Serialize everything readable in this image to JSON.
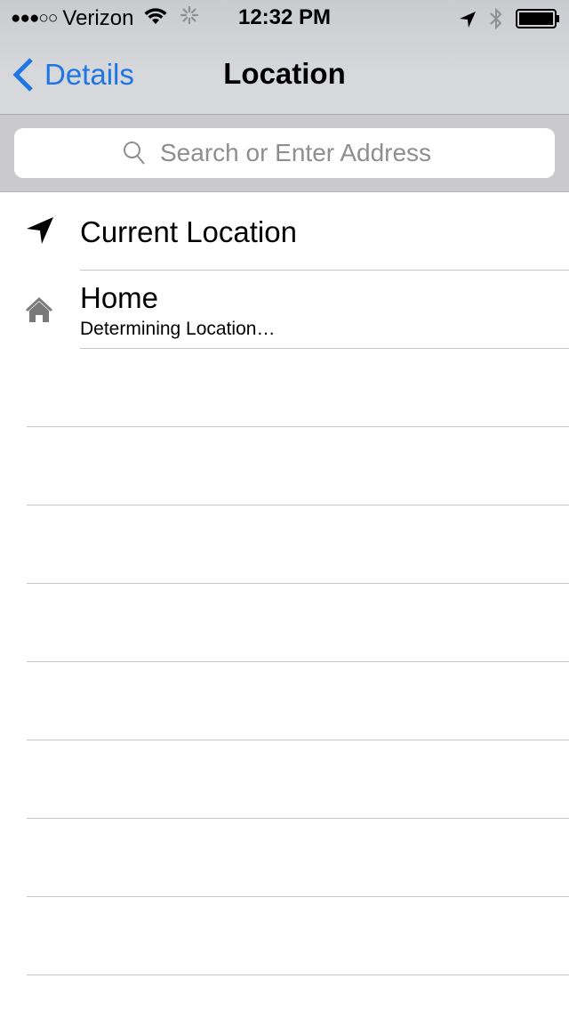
{
  "status_bar": {
    "signal": "●●●○○",
    "carrier": "Verizon",
    "wifi_icon": "wifi-icon",
    "activity_icon": "activity-spinner-icon",
    "time": "12:32 PM",
    "location_icon": "location-arrow-icon",
    "bluetooth_icon": "bluetooth-icon",
    "battery_icon": "battery-full-icon"
  },
  "nav": {
    "back_label": "Details",
    "title": "Location"
  },
  "search": {
    "placeholder": "Search or Enter Address",
    "value": ""
  },
  "list": {
    "items": [
      {
        "icon": "location-arrow-icon",
        "title": "Current Location"
      },
      {
        "icon": "home-icon",
        "title": "Home",
        "subtitle": "Determining Location…"
      }
    ],
    "empty_rows": 8
  },
  "colors": {
    "accent": "#1d76e2",
    "bar_background": "#d6d7db",
    "search_background": "#c9c9ce",
    "separator": "#c8c7cc"
  }
}
